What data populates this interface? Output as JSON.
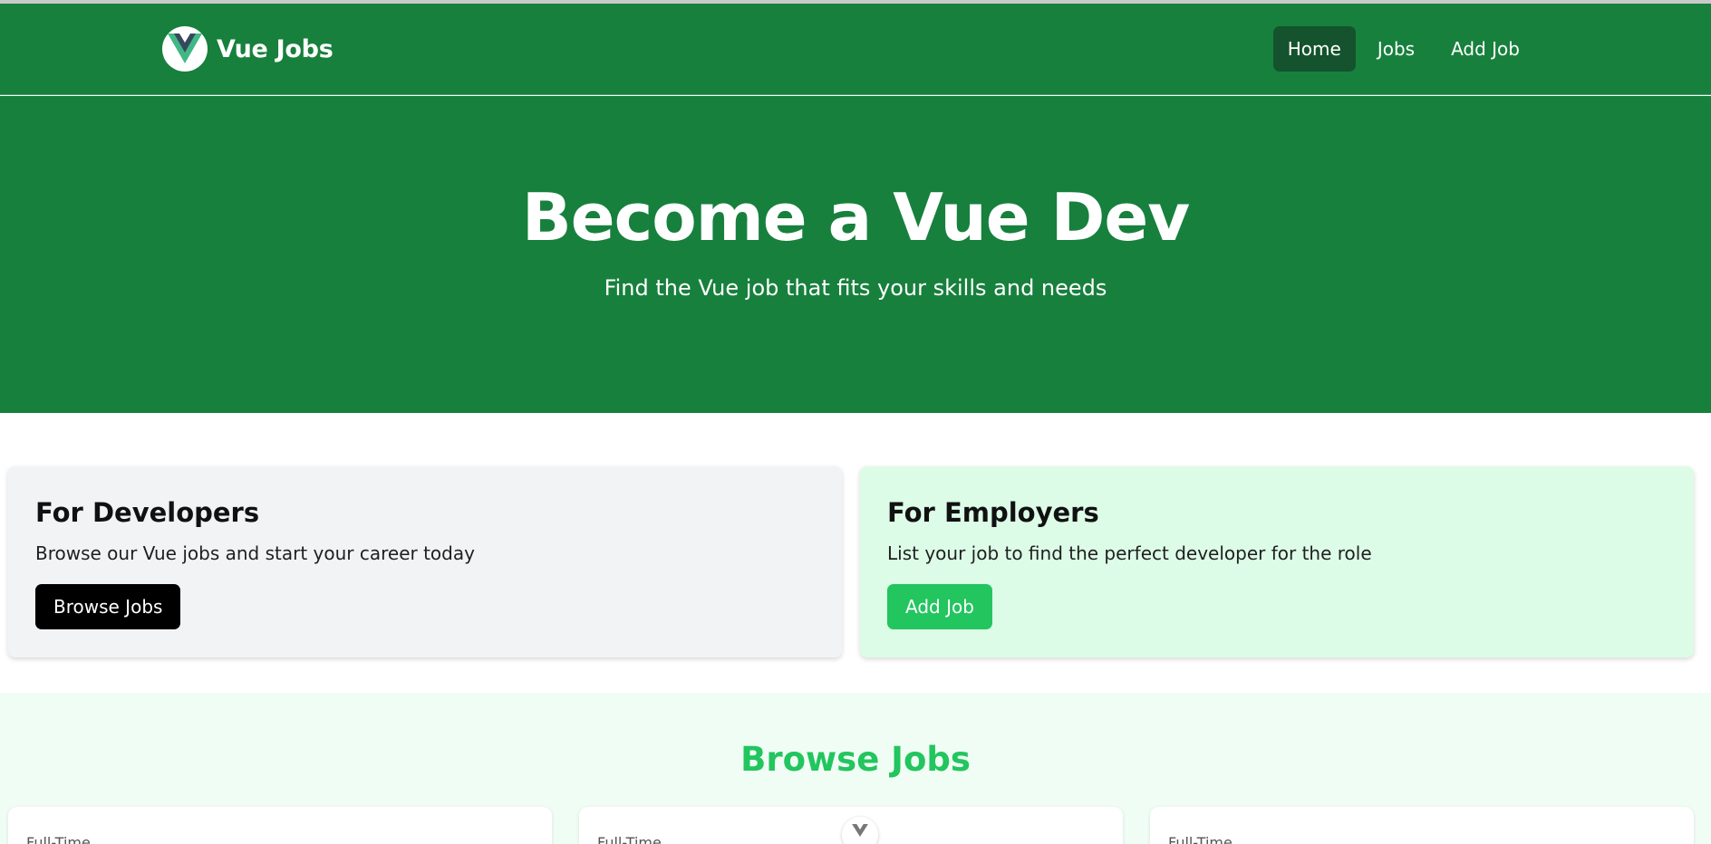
{
  "navbar": {
    "brand": "Vue Jobs",
    "links": [
      {
        "label": "Home",
        "active": true
      },
      {
        "label": "Jobs",
        "active": false
      },
      {
        "label": "Add Job",
        "active": false
      }
    ]
  },
  "hero": {
    "title": "Become a Vue Dev",
    "subtitle": "Find the Vue job that fits your skills and needs"
  },
  "cards": {
    "developers": {
      "title": "For Developers",
      "text": "Browse our Vue jobs and start your career today",
      "button": "Browse Jobs"
    },
    "employers": {
      "title": "For Employers",
      "text": "List your job to find the perfect developer for the role",
      "button": "Add Job"
    }
  },
  "browse": {
    "title": "Browse Jobs",
    "jobs": [
      {
        "type": "Full-Time"
      },
      {
        "type": "Full-Time"
      },
      {
        "type": "Full-Time"
      }
    ]
  },
  "colors": {
    "primary_green": "#17803d",
    "dark_green": "#14532d",
    "accent_green": "#22c55e",
    "light_green": "#dcfce7"
  },
  "icons": [
    "vue-logo-icon"
  ]
}
